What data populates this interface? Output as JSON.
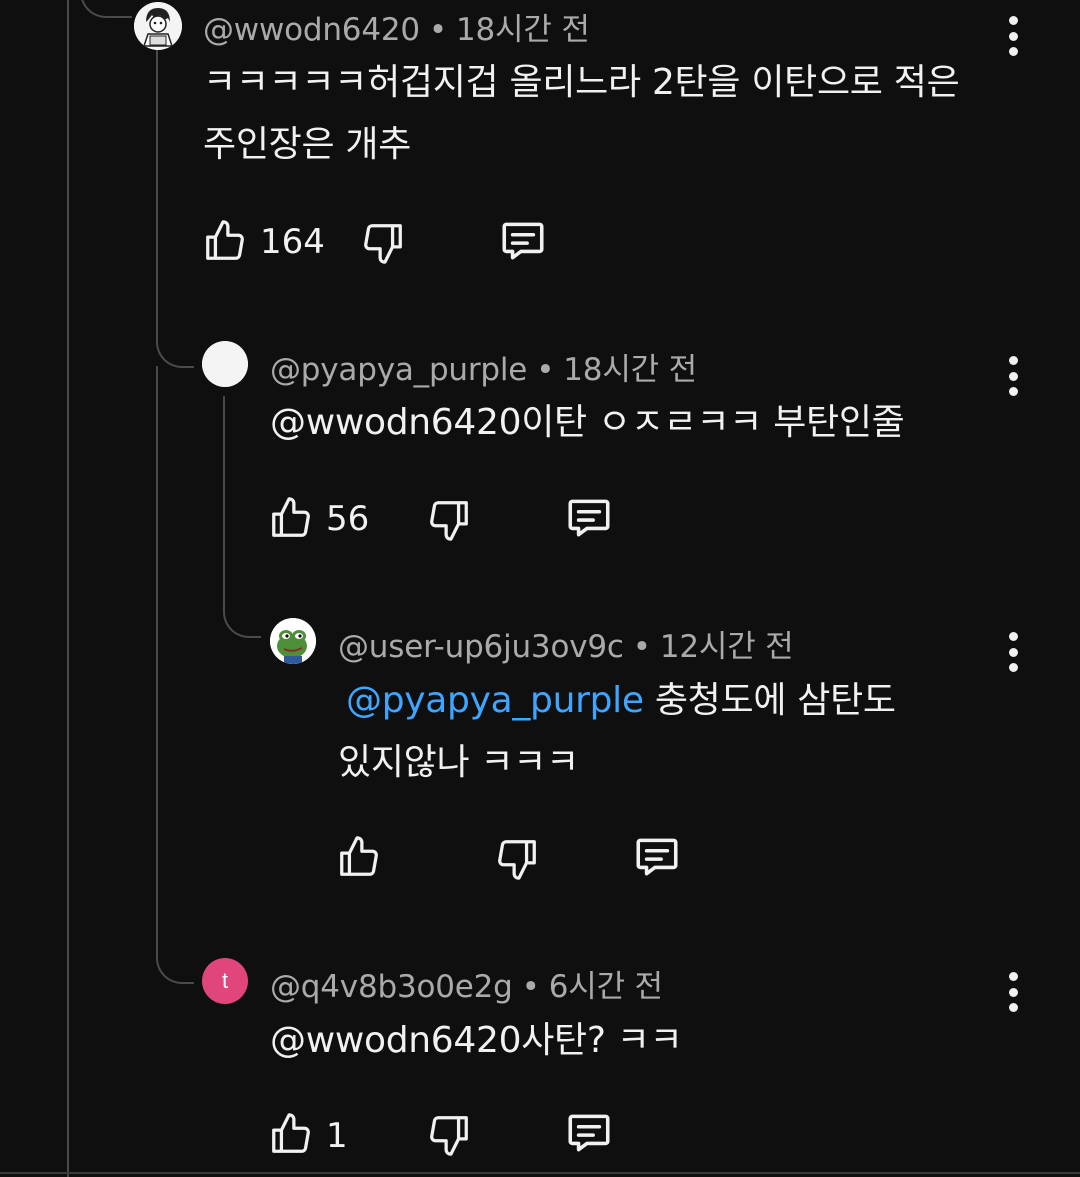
{
  "comments": [
    {
      "handle": "@wwodn6420",
      "time": "18시간 전",
      "separator": "•",
      "body_lines": [
        "ㅋㅋㅋㅋㅋ허겁지겁 올리느라 2탄을 이탄으로 적은",
        "주인장은 개추"
      ],
      "likes": "164",
      "avatar": "drawn-character-avatar"
    },
    {
      "handle": "@pyapya_purple",
      "time": "18시간 전",
      "separator": "•",
      "body_lines": [
        "@wwodn6420이탄 ㅇㅈㄹㅋㅋ 부탄인줄"
      ],
      "likes": "56",
      "avatar": "white-circle-avatar"
    },
    {
      "handle": "@user-up6ju3ov9c",
      "time": "12시간 전",
      "separator": "•",
      "mention": "@pyapya_purple",
      "body_line1_rest": " 충청도에 삼탄도",
      "body_line2": "있지않나 ㅋㅋㅋ",
      "likes": "",
      "avatar": "pepe-frog-avatar"
    },
    {
      "handle": "@q4v8b3o0e2g",
      "time": "6시간 전",
      "separator": "•",
      "body_lines": [
        "@wwodn6420사탄? ㅋㅋ"
      ],
      "likes": "1",
      "avatar_letter": "t",
      "avatar_color": "#e0457b"
    }
  ],
  "icons": {
    "like": "thumbs-up-icon",
    "dislike": "thumbs-down-icon",
    "reply": "reply-comment-icon",
    "more": "more-vertical-icon"
  },
  "colors": {
    "background": "#0f0f10",
    "mention": "#3ea6ff",
    "secondary_text": "#aaaaaa"
  }
}
